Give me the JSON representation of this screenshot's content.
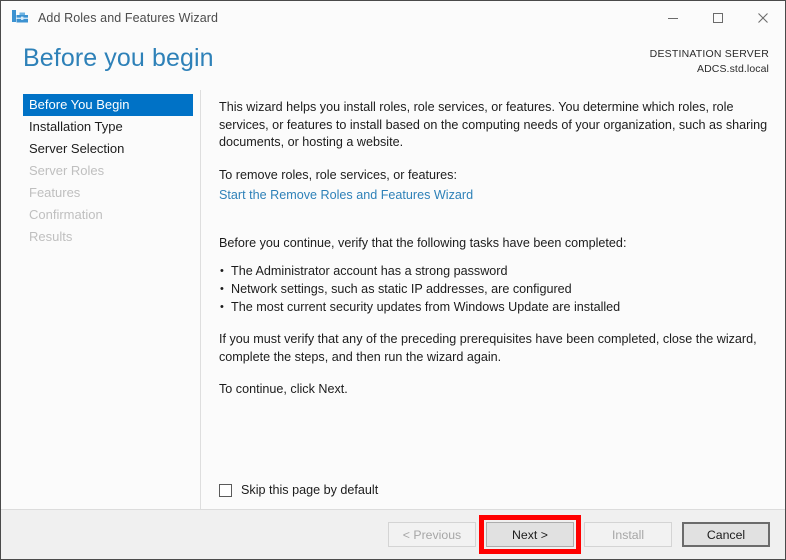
{
  "window": {
    "title": "Add Roles and Features Wizard",
    "icon": "wizard-toolbox-icon",
    "controls": {
      "minimize": "minimize-icon",
      "maximize": "maximize-icon",
      "close": "close-icon"
    }
  },
  "header": {
    "page_title": "Before you begin",
    "destination_label": "DESTINATION SERVER",
    "destination_server": "ADCS.std.local"
  },
  "sidebar": {
    "items": [
      {
        "label": "Before You Begin",
        "state": "selected"
      },
      {
        "label": "Installation Type",
        "state": "enabled"
      },
      {
        "label": "Server Selection",
        "state": "enabled"
      },
      {
        "label": "Server Roles",
        "state": "disabled"
      },
      {
        "label": "Features",
        "state": "disabled"
      },
      {
        "label": "Confirmation",
        "state": "disabled"
      },
      {
        "label": "Results",
        "state": "disabled"
      }
    ]
  },
  "content": {
    "intro_paragraph": "This wizard helps you install roles, role services, or features. You determine which roles, role services, or features to install based on the computing needs of your organization, such as sharing documents, or hosting a website.",
    "remove_lead": "To remove roles, role services, or features:",
    "remove_link": "Start the Remove Roles and Features Wizard",
    "verify_lead": "Before you continue, verify that the following tasks have been completed:",
    "tasks": [
      "The Administrator account has a strong password",
      "Network settings, such as static IP addresses, are configured",
      "The most current security updates from Windows Update are installed"
    ],
    "prereq_paragraph": "If you must verify that any of the preceding prerequisites have been completed, close the wizard, complete the steps, and then run the wizard again.",
    "continue_paragraph": "To continue, click Next.",
    "skip_checkbox_label": "Skip this page by default",
    "skip_checkbox_checked": false
  },
  "footer": {
    "previous_label": "< Previous",
    "next_label": "Next >",
    "install_label": "Install",
    "cancel_label": "Cancel",
    "previous_enabled": false,
    "install_enabled": false,
    "highlight_color": "#ff0000",
    "highlighted_button": "Next >"
  },
  "colors": {
    "accent_blue": "#0072c6",
    "title_blue": "#2e81b8",
    "annotation_red": "#ff0000",
    "window_bg": "#fbfbfb",
    "footer_bg": "#f0f0f0"
  }
}
